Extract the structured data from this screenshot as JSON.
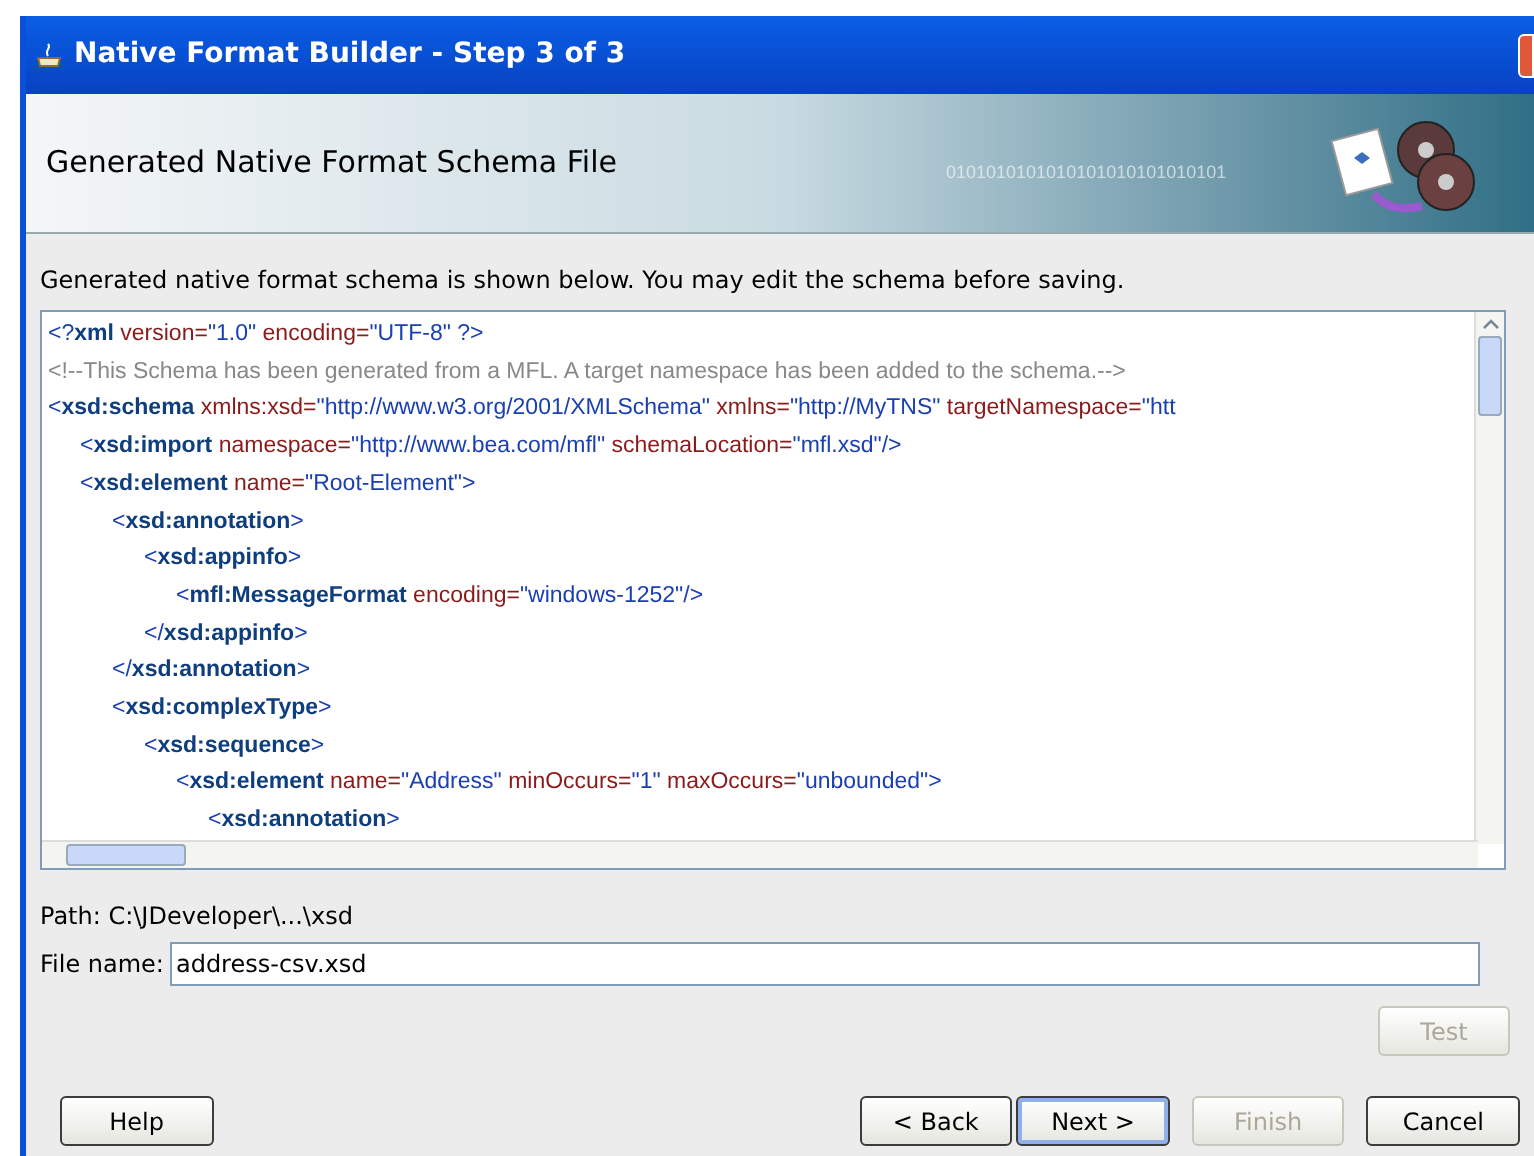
{
  "window": {
    "title": "Native Format Builder - Step 3 of 3"
  },
  "header": {
    "title": "Generated Native Format Schema File",
    "banner_text": "0101010101010101010101010101"
  },
  "description": "Generated native format schema is shown below. You may edit the schema before saving.",
  "editor": {
    "lines": [
      {
        "tokens": [
          {
            "kind": "punct",
            "text": "<?"
          },
          {
            "kind": "tag",
            "text": "xml"
          },
          {
            "kind": "attr",
            "text": " version="
          },
          {
            "kind": "value",
            "text": "\"1.0\""
          },
          {
            "kind": "attr",
            "text": " encoding="
          },
          {
            "kind": "value",
            "text": "\"UTF-8\""
          },
          {
            "kind": "punct",
            "text": " ?>"
          }
        ]
      },
      {
        "tokens": [
          {
            "kind": "comment",
            "text": "<!--This Schema has been generated from a MFL. A target namespace has been added to the schema.-->"
          }
        ]
      },
      {
        "tokens": [
          {
            "kind": "punct",
            "text": "<"
          },
          {
            "kind": "tag",
            "text": "xsd:schema"
          },
          {
            "kind": "attr",
            "text": " xmlns:xsd="
          },
          {
            "kind": "value",
            "text": "\"http://www.w3.org/2001/XMLSchema\""
          },
          {
            "kind": "attr",
            "text": " xmlns="
          },
          {
            "kind": "value",
            "text": "\"http://MyTNS\""
          },
          {
            "kind": "attr",
            "text": " targetNamespace="
          },
          {
            "kind": "value",
            "text": "\"htt"
          }
        ],
        "children": [
          {
            "tokens": [
              {
                "kind": "punct",
                "text": "<"
              },
              {
                "kind": "tag",
                "text": "xsd:import"
              },
              {
                "kind": "attr",
                "text": " namespace="
              },
              {
                "kind": "value",
                "text": "\"http://www.bea.com/mfl\""
              },
              {
                "kind": "attr",
                "text": " schemaLocation="
              },
              {
                "kind": "value",
                "text": "\"mfl.xsd\""
              },
              {
                "kind": "punct",
                "text": "/>"
              }
            ]
          },
          {
            "tokens": [
              {
                "kind": "punct",
                "text": "<"
              },
              {
                "kind": "tag",
                "text": "xsd:element"
              },
              {
                "kind": "attr",
                "text": " name="
              },
              {
                "kind": "value",
                "text": "\"Root-Element\""
              },
              {
                "kind": "punct",
                "text": ">"
              }
            ],
            "children": [
              {
                "tokens": [
                  {
                    "kind": "punct",
                    "text": "<"
                  },
                  {
                    "kind": "tag",
                    "text": "xsd:annotation"
                  },
                  {
                    "kind": "punct",
                    "text": ">"
                  }
                ],
                "children": [
                  {
                    "tokens": [
                      {
                        "kind": "punct",
                        "text": "<"
                      },
                      {
                        "kind": "tag",
                        "text": "xsd:appinfo"
                      },
                      {
                        "kind": "punct",
                        "text": ">"
                      }
                    ],
                    "children": [
                      {
                        "tokens": [
                          {
                            "kind": "punct",
                            "text": "<"
                          },
                          {
                            "kind": "tag",
                            "text": "mfl:MessageFormat"
                          },
                          {
                            "kind": "attr",
                            "text": " encoding="
                          },
                          {
                            "kind": "value",
                            "text": "\"windows-1252\""
                          },
                          {
                            "kind": "punct",
                            "text": "/>"
                          }
                        ]
                      }
                    ]
                  },
                  {
                    "tokens": [
                      {
                        "kind": "punct",
                        "text": "</"
                      },
                      {
                        "kind": "tag",
                        "text": "xsd:appinfo"
                      },
                      {
                        "kind": "punct",
                        "text": ">"
                      }
                    ]
                  }
                ]
              },
              {
                "tokens": [
                  {
                    "kind": "punct",
                    "text": "</"
                  },
                  {
                    "kind": "tag",
                    "text": "xsd:annotation"
                  },
                  {
                    "kind": "punct",
                    "text": ">"
                  }
                ]
              },
              {
                "tokens": [
                  {
                    "kind": "punct",
                    "text": "<"
                  },
                  {
                    "kind": "tag",
                    "text": "xsd:complexType"
                  },
                  {
                    "kind": "punct",
                    "text": ">"
                  }
                ],
                "children": [
                  {
                    "tokens": [
                      {
                        "kind": "punct",
                        "text": "<"
                      },
                      {
                        "kind": "tag",
                        "text": "xsd:sequence"
                      },
                      {
                        "kind": "punct",
                        "text": ">"
                      }
                    ],
                    "children": [
                      {
                        "tokens": [
                          {
                            "kind": "punct",
                            "text": "<"
                          },
                          {
                            "kind": "tag",
                            "text": "xsd:element"
                          },
                          {
                            "kind": "attr",
                            "text": " name="
                          },
                          {
                            "kind": "value",
                            "text": "\"Address\""
                          },
                          {
                            "kind": "attr",
                            "text": " minOccurs="
                          },
                          {
                            "kind": "value",
                            "text": "\"1\""
                          },
                          {
                            "kind": "attr",
                            "text": " maxOccurs="
                          },
                          {
                            "kind": "value",
                            "text": "\"unbounded\""
                          },
                          {
                            "kind": "punct",
                            "text": ">"
                          }
                        ],
                        "children": [
                          {
                            "tokens": [
                              {
                                "kind": "punct",
                                "text": "<"
                              },
                              {
                                "kind": "tag",
                                "text": "xsd:annotation"
                              },
                              {
                                "kind": "punct",
                                "text": ">"
                              }
                            ]
                          }
                        ]
                      }
                    ]
                  }
                ]
              }
            ]
          }
        ]
      }
    ]
  },
  "path": "Path: C:\\JDeveloper\\...\\xsd",
  "file_name": {
    "label": "File name:",
    "value": "address-csv.xsd"
  },
  "test_button": {
    "label": "Test",
    "disabled": true,
    "default": false
  },
  "buttons": [
    {
      "label": "Help",
      "disabled": false,
      "default": false
    },
    {
      "label": "< Back",
      "disabled": false,
      "default": false
    },
    {
      "label": "Next >",
      "disabled": false,
      "default": true
    },
    {
      "label": "Finish",
      "disabled": true,
      "default": false
    },
    {
      "label": "Cancel",
      "disabled": false,
      "default": false
    }
  ]
}
